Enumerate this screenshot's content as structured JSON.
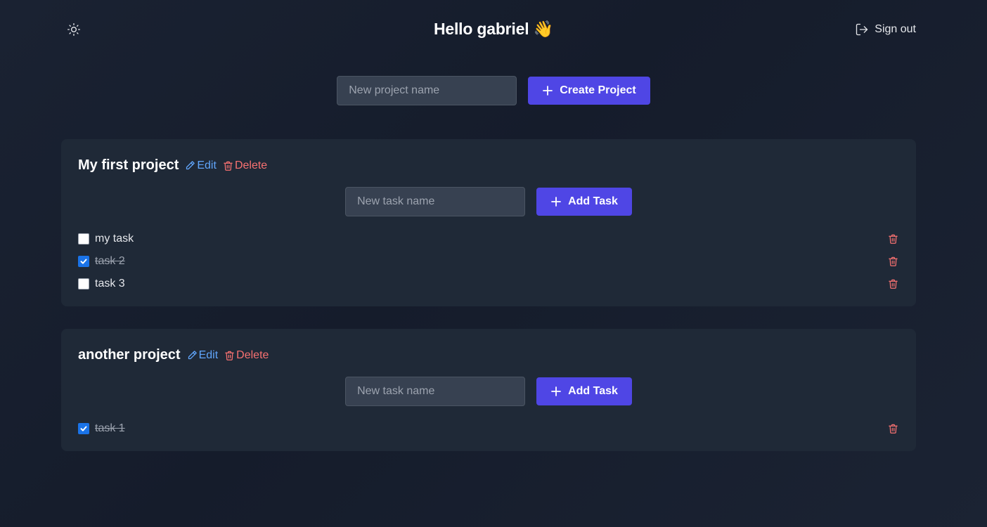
{
  "header": {
    "greeting": "Hello gabriel 👋",
    "signout_label": "Sign out",
    "theme_icon": "sun-icon"
  },
  "create_project": {
    "placeholder": "New project name",
    "button_label": "Create Project"
  },
  "colors": {
    "primary": "#4f46e5",
    "edit_link": "#60a5fa",
    "delete_link": "#f87171",
    "card_bg": "#1f2937"
  },
  "projects": [
    {
      "name": "My first project",
      "edit_label": "Edit",
      "delete_label": "Delete",
      "task_placeholder": "New task name",
      "add_button_label": "Add Task",
      "tasks": [
        {
          "label": "my task",
          "done": false
        },
        {
          "label": "task 2",
          "done": true
        },
        {
          "label": "task 3",
          "done": false
        }
      ]
    },
    {
      "name": "another project",
      "edit_label": "Edit",
      "delete_label": "Delete",
      "task_placeholder": "New task name",
      "add_button_label": "Add Task",
      "tasks": [
        {
          "label": "task 1",
          "done": true
        }
      ]
    }
  ]
}
